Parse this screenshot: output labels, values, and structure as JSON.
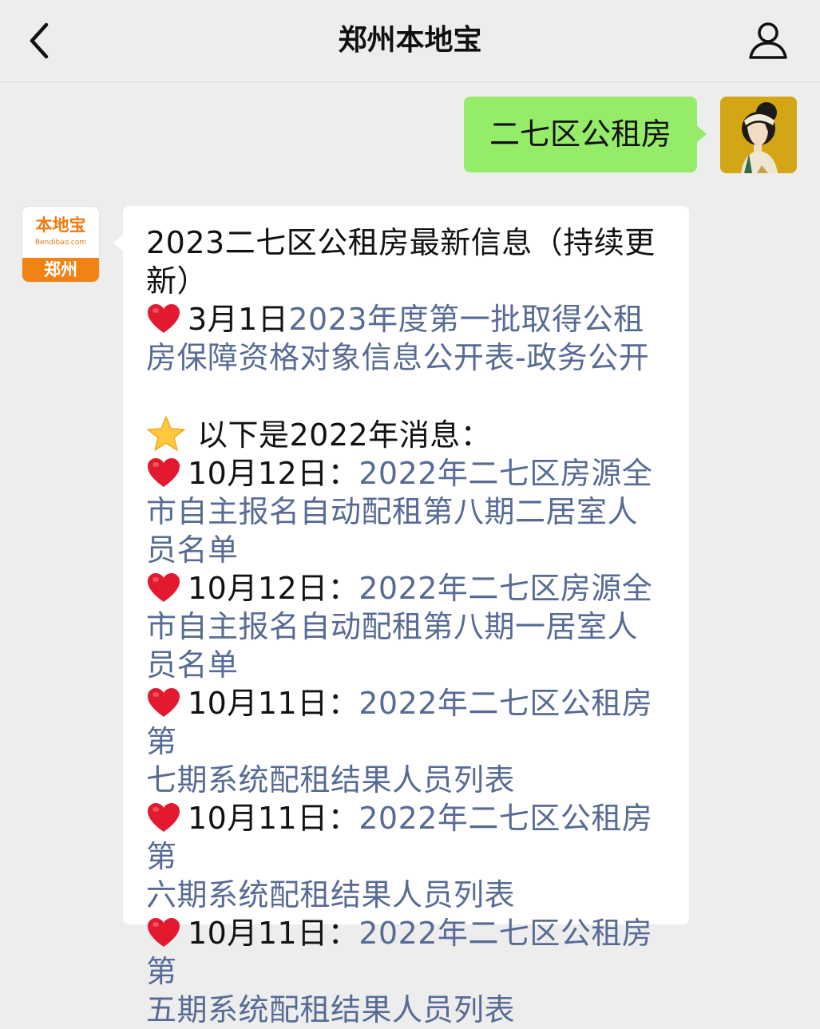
{
  "nav": {
    "title": "郑州本地宝",
    "back_icon": "chevron-left-icon",
    "profile_icon": "person-icon"
  },
  "outgoing": {
    "text": "二七区公租房",
    "bubble_color": "#95ec69"
  },
  "bot_avatar": {
    "logo_text": "本地宝",
    "domain": "Bendibao.com",
    "city": "郑州",
    "brand_color": "#f18214"
  },
  "reply": {
    "title_line1": "2023二七区公租房最新信息（持续更",
    "title_line2": "新）",
    "item1_date": "3月1日",
    "item1_link_line1": "2023年度第一批取得公租",
    "item1_link_line2": "房保障资格对象信息公开表-政务公开",
    "section_note": "以下是2022年消息：",
    "item2_date": "10月12日：",
    "item2_link_line1": "2022年二七区房源全",
    "item2_link_line2": "市自主报名自动配租第八期二居室人",
    "item2_link_line3": "员名单",
    "item3_date": "10月12日：",
    "item3_link_line1": "2022年二七区房源全",
    "item3_link_line2": "市自主报名自动配租第八期一居室人",
    "item3_link_line3": "员名单",
    "item4_date": "10月11日：",
    "item4_link_line1": "2022年二七区公租房第",
    "item4_link_line2": "七期系统配租结果人员列表",
    "item5_date": "10月11日：",
    "item5_link_line1": "2022年二七区公租房第",
    "item5_link_line2": "六期系统配租结果人员列表",
    "item6_date": "10月11日：",
    "item6_link_line1": "2022年二七区公租房第",
    "item6_link_line2": "五期系统配租结果人员列表",
    "link_color": "#576b95",
    "heart_icon": "red-heart-icon",
    "star_icon": "star-icon"
  }
}
